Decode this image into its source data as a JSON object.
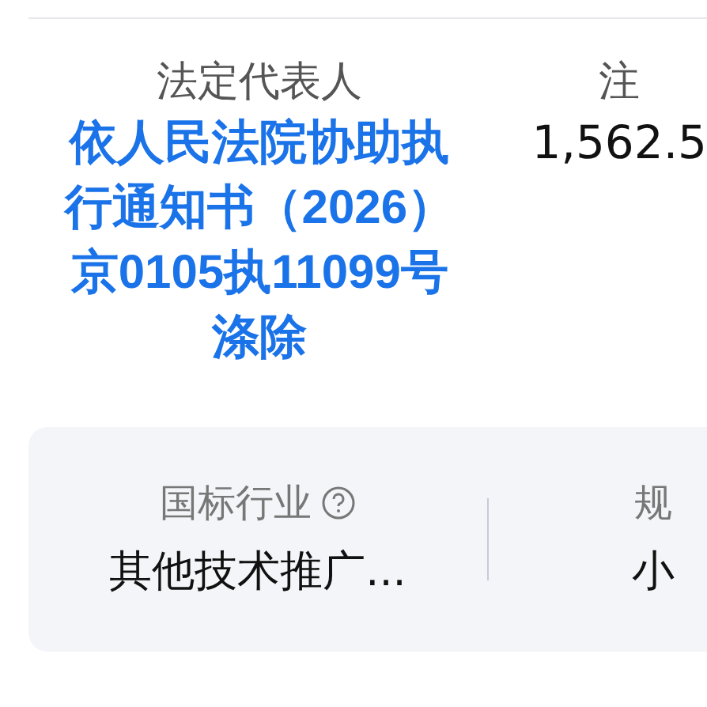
{
  "top_fields": [
    {
      "label": "法定代表人",
      "value": "依人民法院协助执行通知书（2026）京0105执11099号涤除",
      "link": true
    },
    {
      "label": "注",
      "value": "1,562.5",
      "link": false
    }
  ],
  "info_card": [
    {
      "label": "国标行业",
      "help": true,
      "value": "其他技术推广..."
    },
    {
      "label": "规",
      "help": false,
      "value": "小"
    }
  ]
}
